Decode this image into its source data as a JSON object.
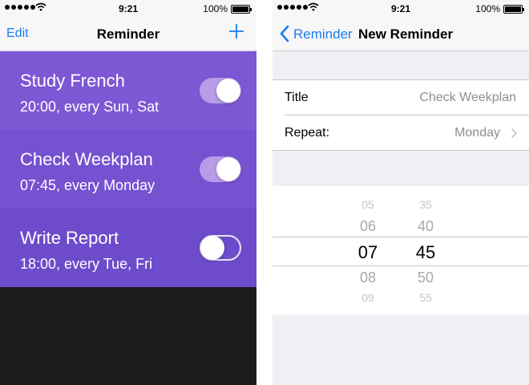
{
  "status_bar": {
    "time": "9:21",
    "battery": "100%"
  },
  "reminder_list": {
    "edit_label": "Edit",
    "title": "Reminder",
    "add_icon": "plus-icon",
    "items": [
      {
        "title": "Study French",
        "schedule": "20:00, every Sun, Sat",
        "enabled": true,
        "color": "#7e57d4"
      },
      {
        "title": "Check Weekplan",
        "schedule": "07:45, every Monday",
        "enabled": true,
        "color": "#7651d0"
      },
      {
        "title": "Write Report",
        "schedule": "18:00, every Tue, Fri",
        "enabled": false,
        "color": "#6e4bca"
      }
    ]
  },
  "new_reminder": {
    "back_label": "Reminder",
    "title": "New Reminder",
    "title_field": {
      "label": "Title",
      "placeholder": "Check Weekplan"
    },
    "repeat_field": {
      "label": "Repeat:",
      "value": "Monday"
    },
    "picker": {
      "hours": [
        "05",
        "06",
        "07",
        "08",
        "09"
      ],
      "minutes": [
        "35",
        "40",
        "45",
        "50",
        "55"
      ],
      "selected_hour": "07",
      "selected_minute": "45"
    }
  },
  "colors": {
    "accent_blue": "#1a7bf2",
    "toggle_on": "#b79ce8",
    "background_dark": "#1c1c1c"
  }
}
